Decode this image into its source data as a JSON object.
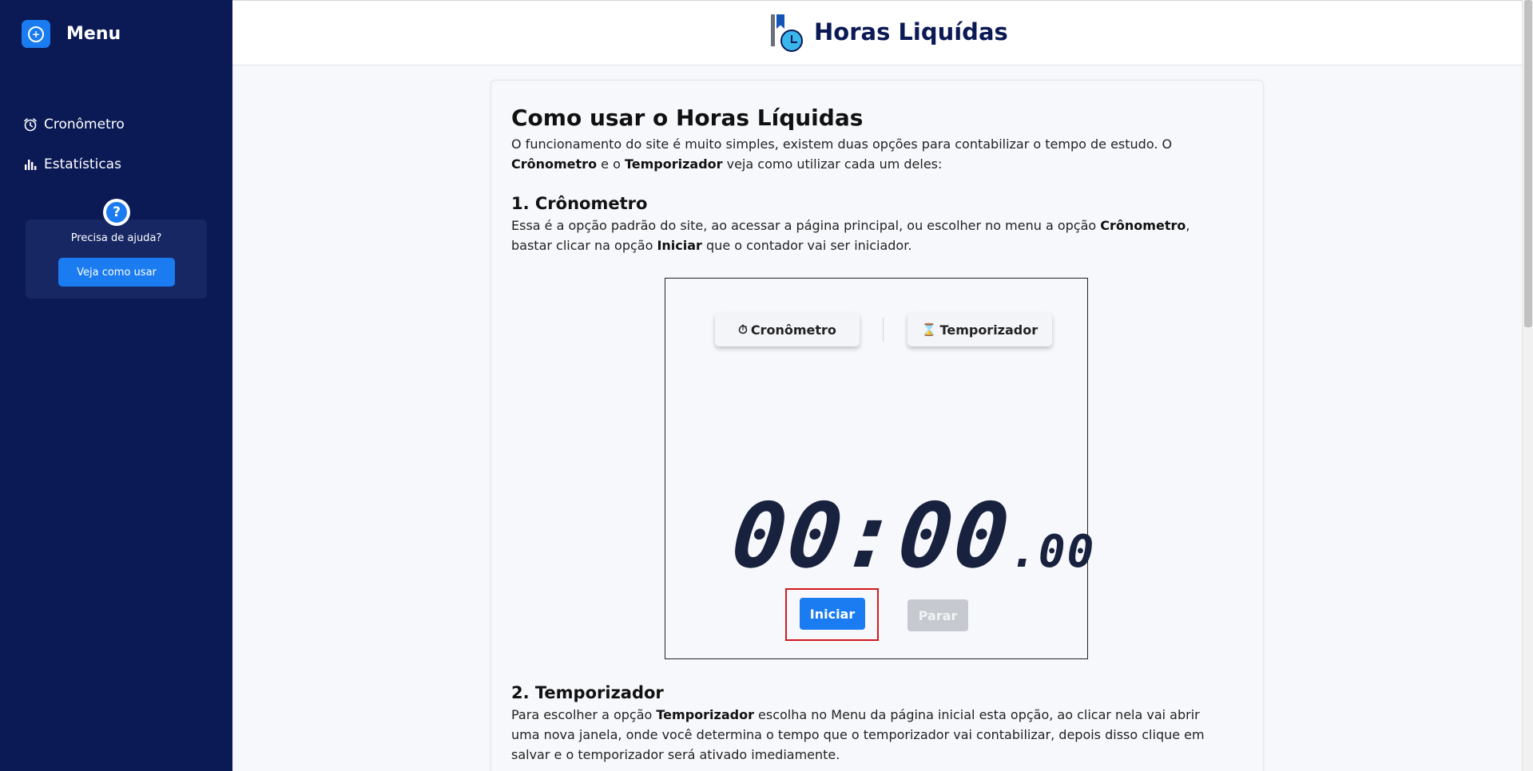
{
  "sidebar": {
    "menu_icon": "plus-circle-icon",
    "menu_title": "Menu",
    "items": [
      {
        "label": "Cronômetro",
        "icon": "alarm-clock-icon"
      },
      {
        "label": "Estatísticas",
        "icon": "bar-chart-icon"
      }
    ],
    "help": {
      "icon": "question-icon",
      "text": "Precisa de ajuda?",
      "button": "Veja como usar"
    }
  },
  "header": {
    "logo_icon": "flag-clock-logo",
    "title": "Horas Liquídas"
  },
  "article": {
    "title": "Como usar o Horas Líquidas",
    "intro": {
      "p1": "O funcionamento do site é muito simples, existem duas opções para contabilizar o tempo de estudo. O ",
      "b1": "Crônometro",
      "p2": " e o ",
      "b2": "Temporizador",
      "p3": " veja como utilizar cada um deles:"
    },
    "section1": {
      "heading": "1. Crônometro",
      "p1": "Essa é a opção padrão do site, ao acessar a página principal, ou escolher no menu a opção ",
      "b1": "Crônometro",
      "p2": ", bastar clicar na opção ",
      "b2": "Iniciar",
      "p3": " que o contador vai ser iniciador."
    },
    "demo": {
      "tab1_label": "Cronômetro",
      "tab1_icon": "stopwatch-icon",
      "tab2_label": "Temporizador",
      "tab2_icon": "hourglass-icon",
      "time_main": "00:00",
      "time_fraction": ".00",
      "start_button": "Iniciar",
      "stop_button": "Parar"
    },
    "section2": {
      "heading": "2. Temporizador",
      "p1": "Para escolher a opção ",
      "b1": "Temporizador",
      "p2": " escolha no Menu da página inicial esta opção, ao clicar nela vai abrir uma nova janela, onde você determina o tempo que o temporizador vai contabilizar, depois disso clique em salvar e o temporizador será ativado imediamente."
    }
  },
  "colors": {
    "sidebar_bg": "#0b1a55",
    "accent": "#1a7cf0",
    "highlight": "#d11a1a"
  }
}
